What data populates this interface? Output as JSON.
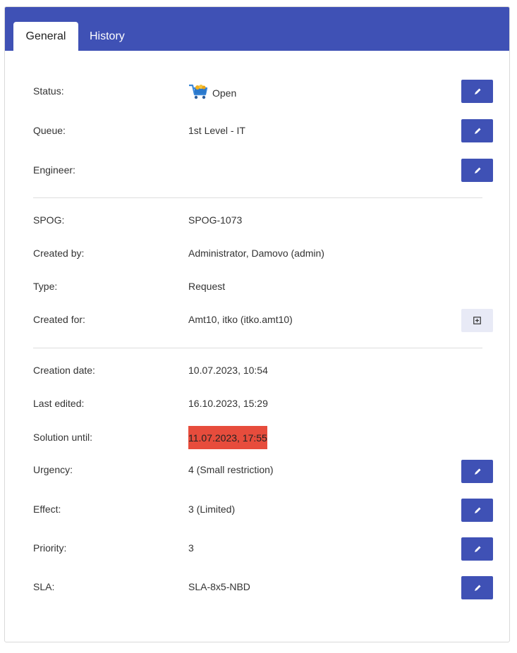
{
  "tabs": [
    {
      "label": "General"
    },
    {
      "label": "History"
    }
  ],
  "status": {
    "label": "Status:",
    "value": "Open",
    "icon": "shopping-cart-icon"
  },
  "queue": {
    "label": "Queue:",
    "value": "1st Level - IT"
  },
  "engineer": {
    "label": "Engineer:",
    "value": ""
  },
  "spog": {
    "label": "SPOG:",
    "value": "SPOG-1073"
  },
  "created_by": {
    "label": "Created by:",
    "value": "Administrator, Damovo (admin)"
  },
  "type": {
    "label": "Type:",
    "value": "Request"
  },
  "created_for": {
    "label": "Created for:",
    "value": "Amt10, itko (itko.amt10)"
  },
  "creation_date": {
    "label": "Creation date:",
    "value": "10.07.2023, 10:54"
  },
  "last_edited": {
    "label": "Last edited:",
    "value": "16.10.2023, 15:29"
  },
  "solution_until": {
    "label": "Solution until:",
    "value": "11.07.2023, 17:55"
  },
  "urgency": {
    "label": "Urgency:",
    "value": "4 (Small restriction)"
  },
  "effect": {
    "label": "Effect:",
    "value": "3 (Limited)"
  },
  "priority": {
    "label": "Priority:",
    "value": "3"
  },
  "sla": {
    "label": "SLA:",
    "value": "SLA-8x5-NBD"
  },
  "colors": {
    "accent": "#3f51b5",
    "overdue": "#e74c3c",
    "add_button_bg": "#e8eaf6"
  }
}
